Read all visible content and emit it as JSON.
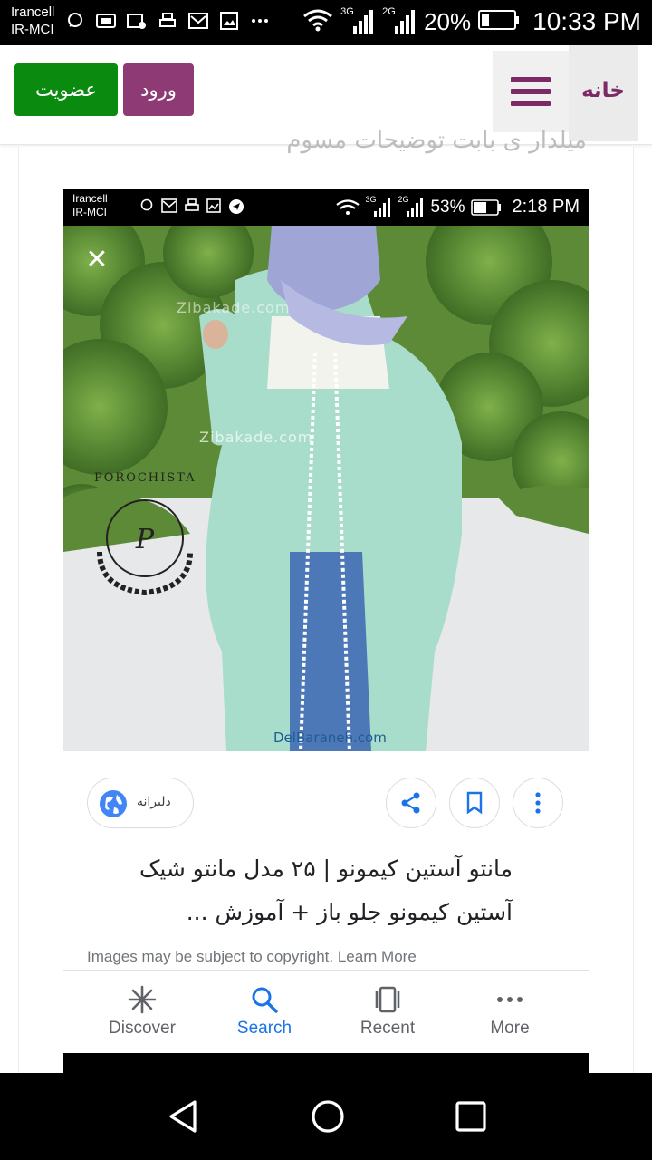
{
  "status_bar": {
    "carrier_line1": "Irancell",
    "carrier_line2": "IR-MCI",
    "network_3g": "3G",
    "network_2g": "2G",
    "battery": "20%",
    "time": "10:33 PM",
    "icons": [
      "chat-icon",
      "sim-icon",
      "image-blocked-icon",
      "print-icon",
      "gmail-icon",
      "image-icon",
      "more-dots-icon"
    ]
  },
  "header": {
    "join_label": "عضویت",
    "login_label": "ورود",
    "home_label": "خانه",
    "brand_color": "#7b2a66",
    "join_color": "#0a8a0f",
    "login_color": "#8e3a74"
  },
  "peek_text": "میلدار ی بابت توضیحات مسوم",
  "inner_screenshot": {
    "carrier_line1": "Irancell",
    "carrier_line2": "IR-MCI",
    "network_3g": "3G",
    "network_2g": "2G",
    "battery": "53%",
    "time": "2:18 PM",
    "watermark_1": "Zibakade.com",
    "watermark_2": "Zibakade.com",
    "watermark_3": "DelBaraneh.com",
    "logo_text": "POROCHISTA"
  },
  "result": {
    "source_label": "دلبرانه",
    "title": "مانتو آستین کیمونو | ۲۵ مدل مانتو شیک آستین کیمونو جلو باز + آموزش ...",
    "copyright": "Images may be subject to copyright. Learn More"
  },
  "google_nav": {
    "discover": "Discover",
    "search": "Search",
    "recent": "Recent",
    "more": "More",
    "active_color": "#1a73e8"
  }
}
